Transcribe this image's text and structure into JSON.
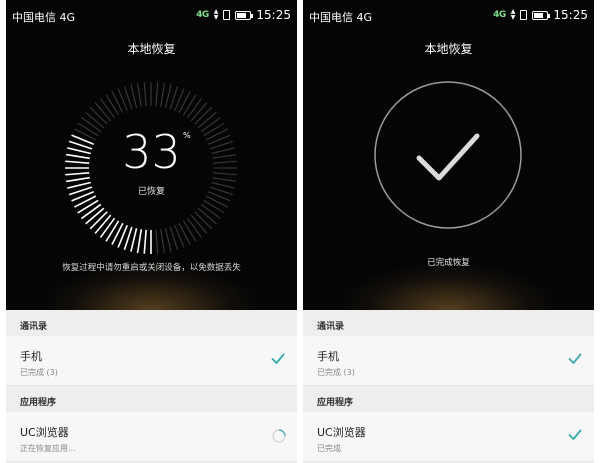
{
  "left": {
    "status_bar": {
      "carrier": "中国电信 4G",
      "network": "4G",
      "time": "15:25"
    },
    "title": "本地恢复",
    "progress": {
      "value": "33",
      "unit": "%",
      "fraction": 0.33,
      "label": "已恢复"
    },
    "warning": "恢复过程中请勿重启或关闭设备，以免数据丢失",
    "sections": [
      {
        "header": "通讯录",
        "items": [
          {
            "name": "手机",
            "status": "已完成 (3)",
            "state_icon": "check-icon"
          }
        ]
      },
      {
        "header": "应用程序",
        "items": [
          {
            "name": "UC浏览器",
            "status": "正在恢复应用...",
            "state_icon": "spinner-icon"
          }
        ]
      }
    ]
  },
  "right": {
    "status_bar": {
      "carrier": "中国电信 4G",
      "network": "4G",
      "time": "15:25"
    },
    "title": "本地恢复",
    "complete_text": "已完成恢复",
    "sections": [
      {
        "header": "通讯录",
        "items": [
          {
            "name": "手机",
            "status": "已完成 (3)",
            "state_icon": "check-icon"
          }
        ]
      },
      {
        "header": "应用程序",
        "items": [
          {
            "name": "UC浏览器",
            "status": "已完成",
            "state_icon": "check-icon"
          }
        ]
      }
    ]
  },
  "colors": {
    "accent": "#3aa9a9",
    "hero_background": "#050505"
  }
}
